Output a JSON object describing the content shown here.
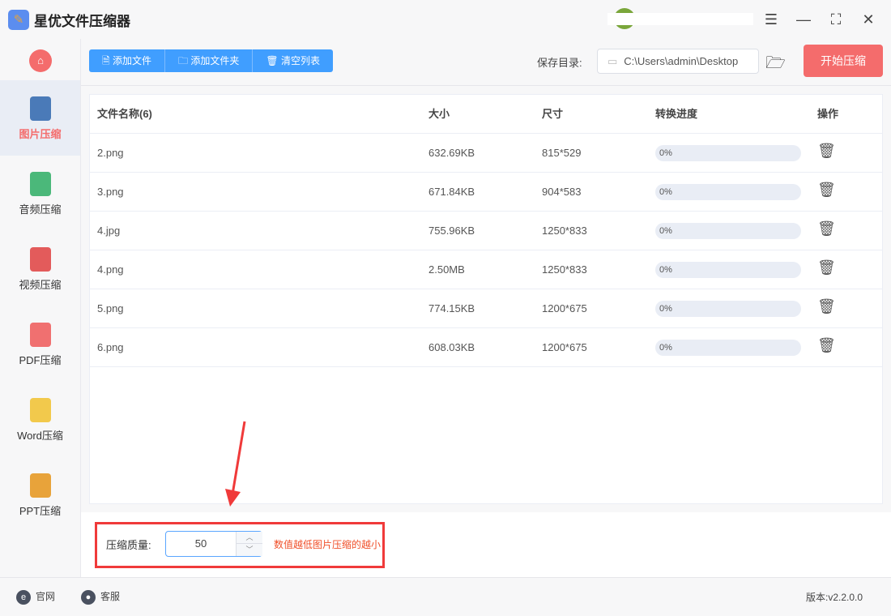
{
  "app": {
    "title": "星优文件压缩器"
  },
  "sidebar": {
    "items": [
      {
        "label": "图片压缩",
        "icon": "image-icon",
        "color": "#4a7ab8"
      },
      {
        "label": "音频压缩",
        "icon": "audio-icon",
        "color": "#4bb87a"
      },
      {
        "label": "视频压缩",
        "icon": "video-icon",
        "color": "#e35b5b"
      },
      {
        "label": "PDF压缩",
        "icon": "pdf-icon",
        "color": "#f07070"
      },
      {
        "label": "Word压缩",
        "icon": "word-icon",
        "color": "#f2c94c"
      },
      {
        "label": "PPT压缩",
        "icon": "ppt-icon",
        "color": "#e8a33a"
      }
    ]
  },
  "toolbar": {
    "add_file": "添加文件",
    "add_folder": "添加文件夹",
    "clear_list": "清空列表",
    "save_label": "保存目录:",
    "save_path": "C:\\Users\\admin\\Desktop",
    "start": "开始压缩"
  },
  "table": {
    "headers": [
      "文件名称(6)",
      "大小",
      "尺寸",
      "转换进度",
      "操作"
    ],
    "rows": [
      {
        "name": "2.png",
        "size": "632.69KB",
        "dim": "815*529",
        "progress": "0%"
      },
      {
        "name": "3.png",
        "size": "671.84KB",
        "dim": "904*583",
        "progress": "0%"
      },
      {
        "name": "4.jpg",
        "size": "755.96KB",
        "dim": "1250*833",
        "progress": "0%"
      },
      {
        "name": "4.png",
        "size": "2.50MB",
        "dim": "1250*833",
        "progress": "0%"
      },
      {
        "name": "5.png",
        "size": "774.15KB",
        "dim": "1200*675",
        "progress": "0%"
      },
      {
        "name": "6.png",
        "size": "608.03KB",
        "dim": "1200*675",
        "progress": "0%"
      }
    ]
  },
  "quality": {
    "label": "压缩质量:",
    "value": "50",
    "hint": "数值越低图片压缩的越小"
  },
  "footer": {
    "website": "官网",
    "support": "客服",
    "version": "版本:v2.2.0.0"
  }
}
